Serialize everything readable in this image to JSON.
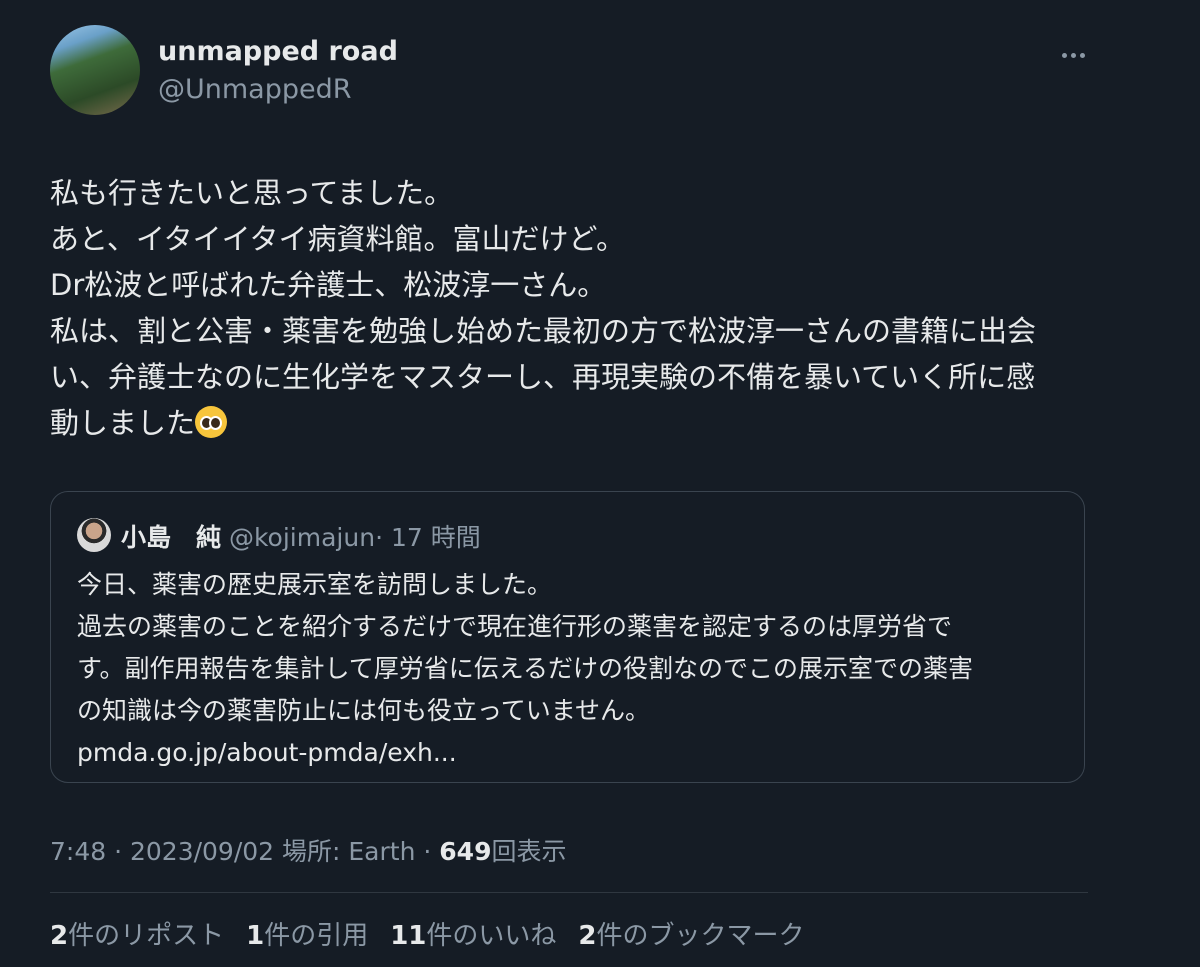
{
  "author": {
    "name": "unmapped road",
    "handle": "@UnmappedR"
  },
  "tweet": {
    "lines": [
      "私も行きたいと思ってました。",
      "あと、イタイイタイ病資料館。富山だけど。",
      "Dr松波と呼ばれた弁護士、松波淳一さん。",
      "私は、割と公害・薬害を勉強し始めた最初の方で松波淳一さんの書籍に出会",
      "い、弁護士なのに生化学をマスターし、再現実験の不備を暴いていく所に感",
      "動しました"
    ],
    "emoji": "pleading-face-emoji"
  },
  "quote": {
    "name": "小島　純",
    "handle": "@kojimajun",
    "time": "· 17 時間",
    "lines": [
      "今日、薬害の歴史展示室を訪問しました。",
      "過去の薬害のことを紹介するだけで現在進行形の薬害を認定するのは厚労省で",
      "す。副作用報告を集計して厚労省に伝えるだけの役割なのでこの展示室での薬害",
      "の知識は今の薬害防止には何も役立っていません。",
      "pmda.go.jp/about-pmda/exh..."
    ]
  },
  "meta": {
    "time_location": "7:48 · 2023/09/02 場所: Earth · ",
    "views_count": "649",
    "views_label": "回表示"
  },
  "stats": [
    {
      "num": "2",
      "label": "件のリポスト"
    },
    {
      "num": "1",
      "label": "件の引用"
    },
    {
      "num": "11",
      "label": "件のいいね"
    },
    {
      "num": "2",
      "label": "件のブックマーク"
    }
  ],
  "colors": {
    "background": "#151c25",
    "text": "#e7e9ea",
    "muted": "#8b98a5",
    "border": "#3a444f"
  }
}
